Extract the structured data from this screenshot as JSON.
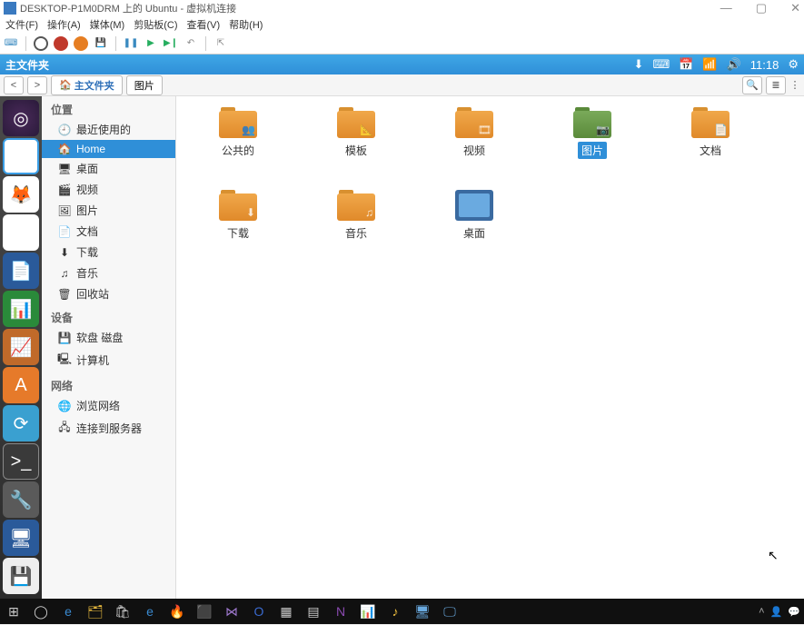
{
  "vm": {
    "title": "DESKTOP-P1M0DRM 上的 Ubuntu - 虚拟机连接",
    "menus": [
      "文件(F)",
      "操作(A)",
      "媒体(M)",
      "剪贴板(C)",
      "查看(V)",
      "帮助(H)"
    ],
    "winctrls": {
      "min": "—",
      "max": "▢",
      "close": "✕"
    }
  },
  "ubuntu_topbar": {
    "title": "主文件夹",
    "time": "11:18"
  },
  "pathbar": {
    "back": "<",
    "forward": ">",
    "home_label": "主文件夹",
    "segments": [
      "图片"
    ]
  },
  "launcher": [
    {
      "name": "ubuntu-dash",
      "glyph": "◎",
      "cls": "li-ubuntu"
    },
    {
      "name": "files",
      "glyph": "🗂",
      "cls": "li-files"
    },
    {
      "name": "firefox",
      "glyph": "🦊",
      "cls": "li-ff"
    },
    {
      "name": "chromium",
      "glyph": "◯",
      "cls": "li-chrome"
    },
    {
      "name": "writer",
      "glyph": "📄",
      "cls": "li-writer"
    },
    {
      "name": "calc",
      "glyph": "📊",
      "cls": "li-calc"
    },
    {
      "name": "impress",
      "glyph": "📈",
      "cls": "li-impress"
    },
    {
      "name": "software",
      "glyph": "A",
      "cls": "li-sw"
    },
    {
      "name": "updater",
      "glyph": "⟳",
      "cls": "li-up"
    },
    {
      "name": "terminal",
      "glyph": ">_",
      "cls": "li-term"
    },
    {
      "name": "tools",
      "glyph": "🔧",
      "cls": "li-tool"
    },
    {
      "name": "displays",
      "glyph": "🖥",
      "cls": "li-disp"
    },
    {
      "name": "save",
      "glyph": "💾",
      "cls": "li-save"
    }
  ],
  "sidebar": {
    "places_header": "位置",
    "places": [
      {
        "icon": "🕘",
        "label": "最近使用的",
        "name": "recent"
      },
      {
        "icon": "🏠",
        "label": "Home",
        "name": "home",
        "selected": true
      },
      {
        "icon": "🖥",
        "label": "桌面",
        "name": "desktop"
      },
      {
        "icon": "🎬",
        "label": "视频",
        "name": "videos"
      },
      {
        "icon": "🖼",
        "label": "图片",
        "name": "pictures"
      },
      {
        "icon": "📄",
        "label": "文档",
        "name": "documents"
      },
      {
        "icon": "⬇",
        "label": "下载",
        "name": "downloads"
      },
      {
        "icon": "♫",
        "label": "音乐",
        "name": "music"
      },
      {
        "icon": "🗑",
        "label": "回收站",
        "name": "trash"
      }
    ],
    "devices_header": "设备",
    "devices": [
      {
        "icon": "💾",
        "label": "软盘 磁盘",
        "name": "floppy"
      },
      {
        "icon": "🖳",
        "label": "计算机",
        "name": "computer"
      }
    ],
    "network_header": "网络",
    "network": [
      {
        "icon": "🌐",
        "label": "浏览网络",
        "name": "browse-network"
      },
      {
        "icon": "🖧",
        "label": "连接到服务器",
        "name": "connect-server"
      }
    ]
  },
  "folders": [
    {
      "label": "公共的",
      "name": "public",
      "overlay": "👥"
    },
    {
      "label": "模板",
      "name": "templates",
      "overlay": "📐"
    },
    {
      "label": "视频",
      "name": "videos",
      "overlay": "🎞"
    },
    {
      "label": "图片",
      "name": "pictures",
      "overlay": "📷",
      "green": true,
      "selected": true
    },
    {
      "label": "文档",
      "name": "documents",
      "overlay": "📄"
    },
    {
      "label": "下载",
      "name": "downloads",
      "overlay": "⬇"
    },
    {
      "label": "音乐",
      "name": "music",
      "overlay": "♫"
    },
    {
      "label": "桌面",
      "name": "desktop-folder",
      "desktop": true
    }
  ]
}
